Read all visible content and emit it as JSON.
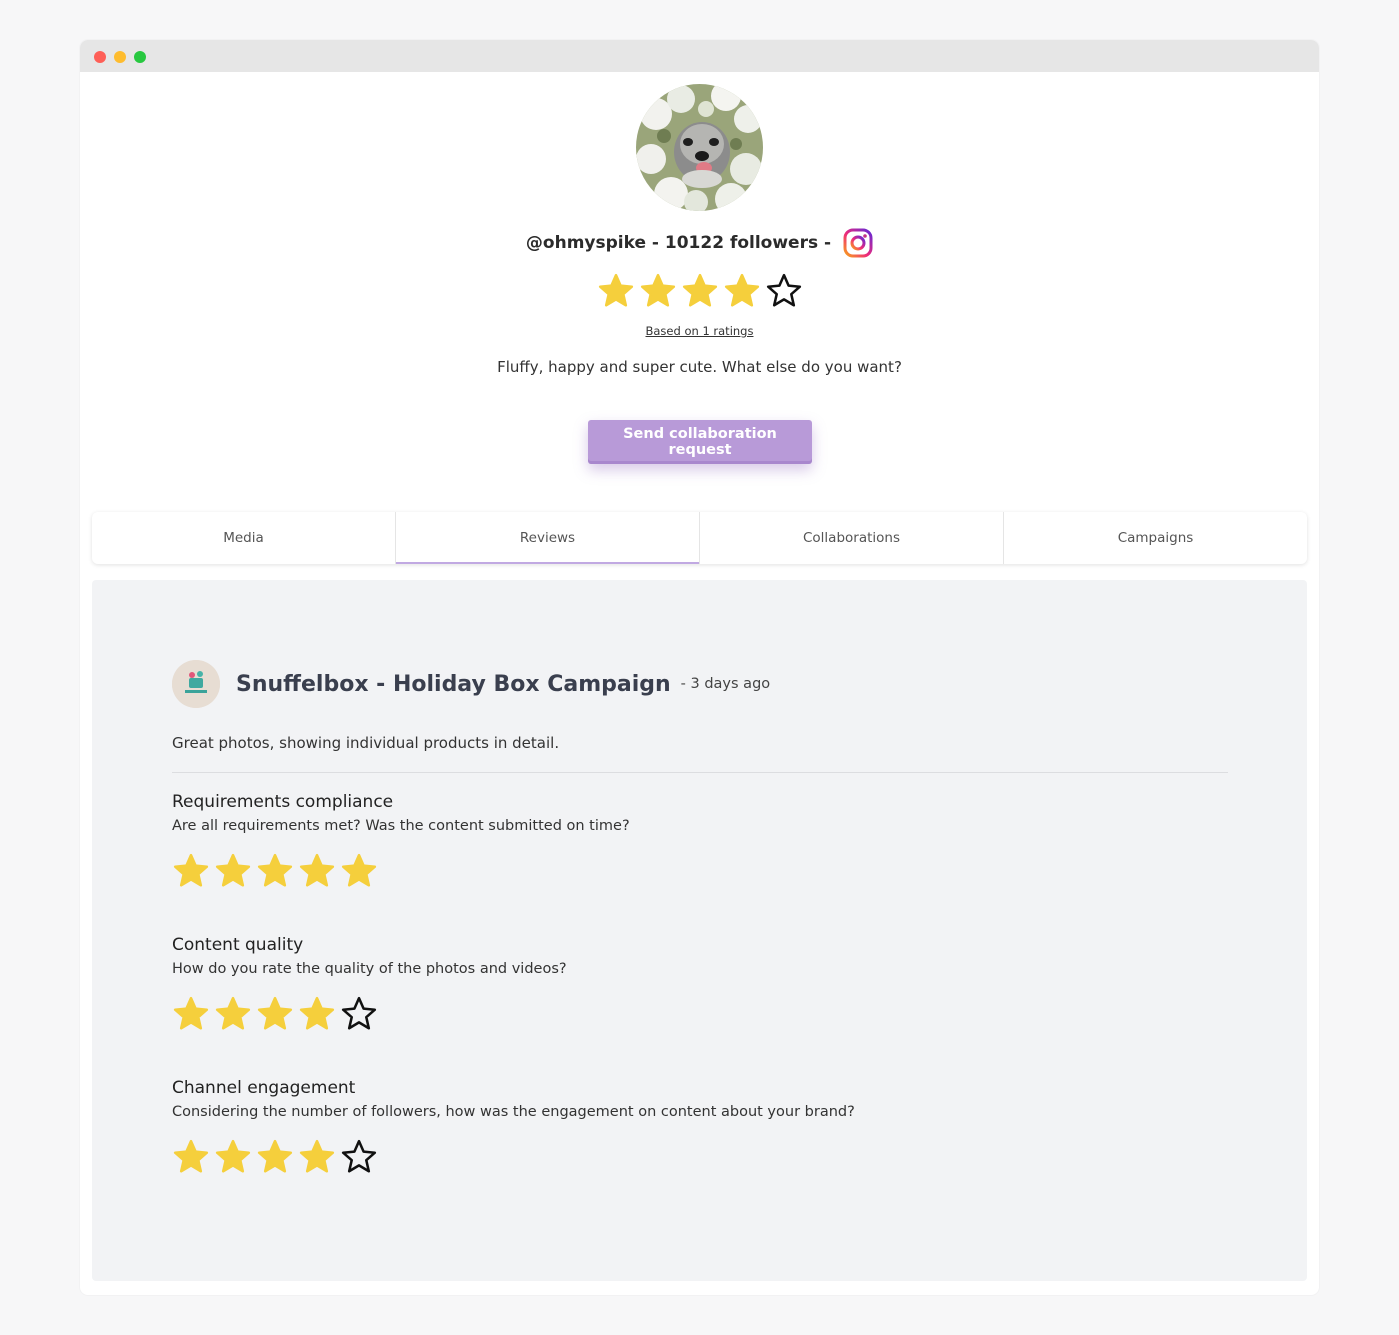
{
  "window": {
    "controls": [
      "close",
      "minimize",
      "maximize"
    ]
  },
  "profile": {
    "handle_line": "@ohmyspike - 10122 followers -",
    "social_icon": "instagram-icon",
    "rating": 4,
    "rating_max": 5,
    "based_on": "Based on 1 ratings",
    "bio": "Fluffy, happy and super cute. What else do you want?",
    "collab_button": "Send collaboration request"
  },
  "tabs": [
    {
      "label": "Media",
      "active": false
    },
    {
      "label": "Reviews",
      "active": true
    },
    {
      "label": "Collaborations",
      "active": false
    },
    {
      "label": "Campaigns",
      "active": false
    }
  ],
  "review": {
    "title": "Snuffelbox - Holiday Box Campaign",
    "time": "- 3 days ago",
    "text": "Great photos, showing individual products in detail.",
    "criteria": [
      {
        "title": "Requirements compliance",
        "description": "Are all requirements met? Was the content submitted on time?",
        "rating": 5
      },
      {
        "title": "Content quality",
        "description": "How do you rate the quality of the photos and videos?",
        "rating": 4
      },
      {
        "title": "Channel engagement",
        "description": "Considering the number of followers, how was the engagement on content about your brand?",
        "rating": 4
      }
    ]
  },
  "colors": {
    "star_filled": "#f5cf3c",
    "star_empty_stroke": "#111111",
    "accent": "#b89ad8",
    "active_tab_underline": "#c1a9e2",
    "panel_bg": "#f2f3f5"
  }
}
